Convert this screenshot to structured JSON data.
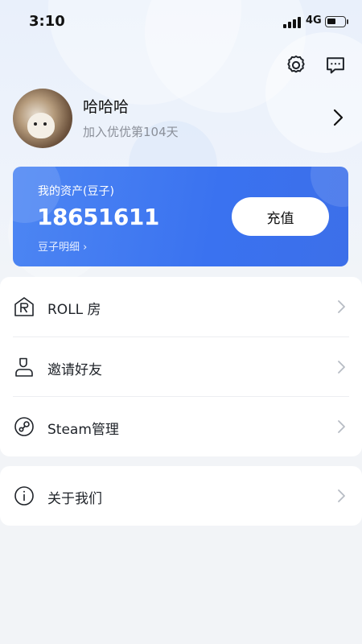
{
  "status_bar": {
    "time": "3:10",
    "network": "4G"
  },
  "header": {
    "icons": [
      "gear-icon",
      "message-icon"
    ]
  },
  "profile": {
    "username": "哈哈哈",
    "join_days": "加入优优第104天"
  },
  "assets": {
    "label": "我的资产(豆子)",
    "value": "18651611",
    "detail_link": "豆子明细 ›",
    "recharge_label": "充值",
    "accent_color": "#3d74f0"
  },
  "menu": {
    "group1": [
      {
        "label": "ROLL 房",
        "icon": "roll-room-icon"
      },
      {
        "label": "邀请好友",
        "icon": "user-icon"
      },
      {
        "label": "Steam管理",
        "icon": "steam-icon"
      }
    ],
    "group2": [
      {
        "label": "关于我们",
        "icon": "info-icon"
      }
    ]
  }
}
